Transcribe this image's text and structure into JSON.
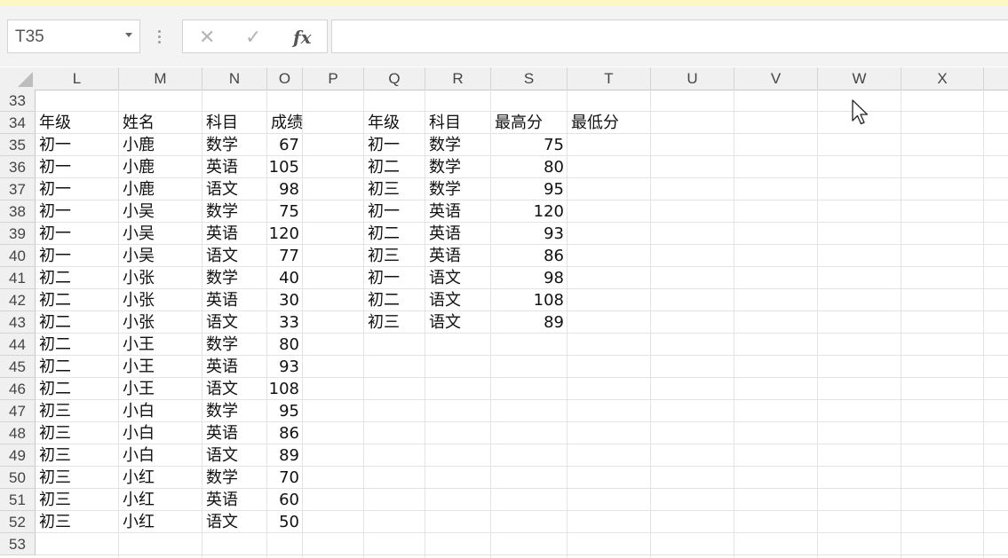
{
  "formula_bar": {
    "name_box": "T35",
    "cancel_icon": "✕",
    "enter_icon": "✓",
    "fx_label": "fx",
    "formula": ""
  },
  "columns": [
    "L",
    "M",
    "N",
    "O",
    "P",
    "Q",
    "R",
    "S",
    "T",
    "U",
    "V",
    "W",
    "X"
  ],
  "row_numbers": [
    "33",
    "34",
    "35",
    "36",
    "37",
    "38",
    "39",
    "40",
    "41",
    "42",
    "43",
    "44",
    "45",
    "46",
    "47",
    "48",
    "49",
    "50",
    "51",
    "52",
    "53"
  ],
  "left_table": {
    "headers": [
      "年级",
      "姓名",
      "科目",
      "成绩"
    ],
    "rows": [
      [
        "初一",
        "小鹿",
        "数学",
        "67"
      ],
      [
        "初一",
        "小鹿",
        "英语",
        "105"
      ],
      [
        "初一",
        "小鹿",
        "语文",
        "98"
      ],
      [
        "初一",
        "小吴",
        "数学",
        "75"
      ],
      [
        "初一",
        "小吴",
        "英语",
        "120"
      ],
      [
        "初一",
        "小吴",
        "语文",
        "77"
      ],
      [
        "初二",
        "小张",
        "数学",
        "40"
      ],
      [
        "初二",
        "小张",
        "英语",
        "30"
      ],
      [
        "初二",
        "小张",
        "语文",
        "33"
      ],
      [
        "初二",
        "小王",
        "数学",
        "80"
      ],
      [
        "初二",
        "小王",
        "英语",
        "93"
      ],
      [
        "初二",
        "小王",
        "语文",
        "108"
      ],
      [
        "初三",
        "小白",
        "数学",
        "95"
      ],
      [
        "初三",
        "小白",
        "英语",
        "86"
      ],
      [
        "初三",
        "小白",
        "语文",
        "89"
      ],
      [
        "初三",
        "小红",
        "数学",
        "70"
      ],
      [
        "初三",
        "小红",
        "英语",
        "60"
      ],
      [
        "初三",
        "小红",
        "语文",
        "50"
      ]
    ]
  },
  "right_table": {
    "headers": [
      "年级",
      "科目",
      "最高分",
      "最低分"
    ],
    "rows": [
      [
        "初一",
        "数学",
        "75"
      ],
      [
        "初二",
        "数学",
        "80"
      ],
      [
        "初三",
        "数学",
        "95"
      ],
      [
        "初一",
        "英语",
        "120"
      ],
      [
        "初二",
        "英语",
        "93"
      ],
      [
        "初三",
        "英语",
        "86"
      ],
      [
        "初一",
        "语文",
        "98"
      ],
      [
        "初二",
        "语文",
        "108"
      ],
      [
        "初三",
        "语文",
        "89"
      ]
    ]
  }
}
